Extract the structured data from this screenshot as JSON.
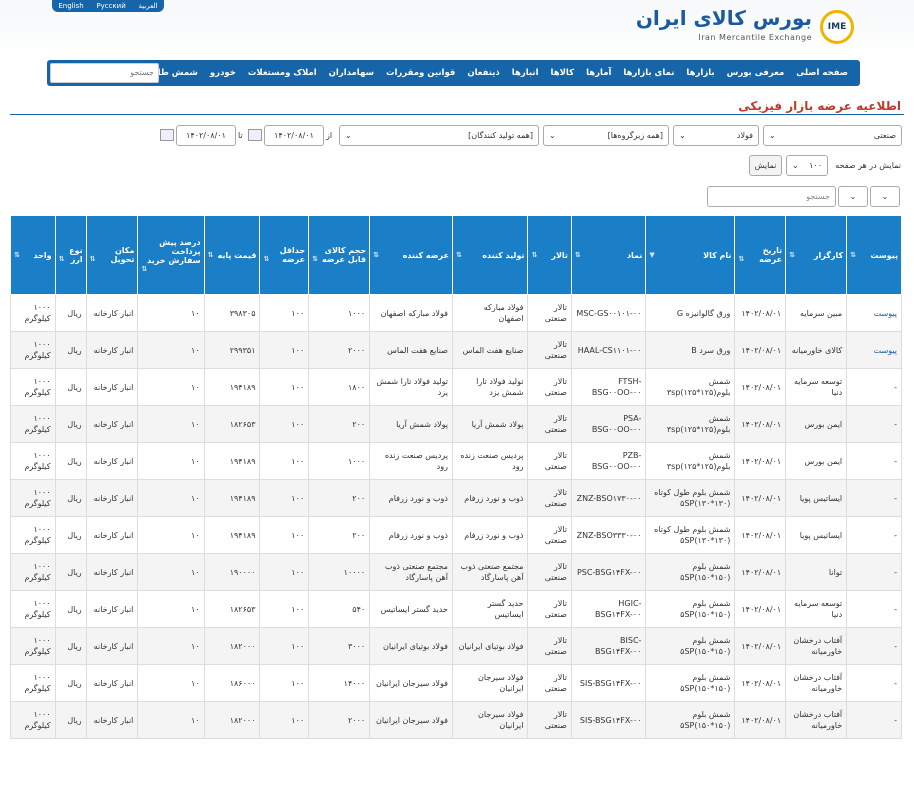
{
  "header": {
    "languages": [
      "English",
      "Русский",
      "العربية"
    ],
    "logo_fa": "بورس کالای ایران",
    "logo_en": "Iran Mercantile Exchange",
    "logo_mark": "IME"
  },
  "nav": {
    "items": [
      "صفحه اصلی",
      "معرفی بورس",
      "بازارها",
      "نمای بازارها",
      "آمارها",
      "کالاها",
      "انبارها",
      "ذینفعان",
      "قوانین ومقررات",
      "سهامداران",
      "املاک ومستغلات",
      "خودرو",
      "شمش طلا"
    ],
    "search_placeholder": "جستجو"
  },
  "page": {
    "title": "اطلاعیه عرضه بازار فیزیکی"
  },
  "filters": {
    "market": "صنعتی",
    "group": "فولاد",
    "subgroup": "[همه زیرگروه‌ها]",
    "producer": "[همه تولید کنندگان]",
    "from_label": "از",
    "from_date": "۱۴۰۲/۰۸/۰۱",
    "to_label": "تا",
    "to_date": "۱۴۰۲/۰۸/۰۱",
    "per_page_label": "نمایش در هر صفحه",
    "per_page": "۱۰۰",
    "show_button": "نمایش",
    "table_search_placeholder": "جستجو"
  },
  "table": {
    "columns": [
      "پیوست",
      "کارگزار",
      "تاریخ عرضه",
      "نام کالا",
      "نماد",
      "تالار",
      "تولید کننده",
      "عرضه کننده",
      "حجم کالای قابل عرضه",
      "حداقل عرضه",
      "قیمت پایه",
      "درصد پیش پرداخت سفارش خرید",
      "مکان تحویل",
      "نوع ارز",
      "واحد"
    ],
    "rows": [
      [
        "پیوست",
        "مبین سرمایه",
        "۱۴۰۲/۰۸/۰۱",
        "ورق گالوانیزه G",
        "MSC-GS۰۰۱۰۱-۰۰",
        "تالار صنعتی",
        "فولاد مبارکه اصفهان",
        "فولاد مبارکه اصفهان",
        "۱۰۰۰",
        "۱۰۰",
        "۳۹۸۳۰۵",
        "۱۰",
        "انبار کارخانه",
        "ریال",
        "۱۰۰۰ کیلوگرم"
      ],
      [
        "پیوست",
        "کالای خاورمیانه",
        "۱۴۰۲/۰۸/۰۱",
        "ورق سرد B",
        "HAAL-CS۱۱۰۱-۰۰",
        "تالار صنعتی",
        "صنایع هفت الماس",
        "صنایع هفت الماس",
        "۲۰۰۰",
        "۱۰۰",
        "۲۹۹۳۵۱",
        "۱۰",
        "انبار کارخانه",
        "ریال",
        "۱۰۰۰ کیلوگرم"
      ],
      [
        "-",
        "توسعه سرمایه دنیا",
        "۱۴۰۲/۰۸/۰۱",
        "شمش بلوم(۱۲۵*۱۲۵)۳sp",
        "FTSH-BSG۰۰OO-۰۰",
        "تالار صنعتی",
        "تولید فولاد تارا شمش یزد",
        "تولید فولاد تارا شمش یزد",
        "۱۸۰۰",
        "۱۰۰",
        "۱۹۴۱۸۹",
        "۱۰",
        "انبار کارخانه",
        "ریال",
        "۱۰۰۰ کیلوگرم"
      ],
      [
        "-",
        "ایمن بورس",
        "۱۴۰۲/۰۸/۰۱",
        "شمش بلوم(۱۲۵*۱۲۵)۳sp",
        "PSA-BSG۰۰OO-۰۰",
        "تالار صنعتی",
        "پولاد شمش آریا",
        "پولاد شمش آریا",
        "۲۰۰",
        "۱۰۰",
        "۱۸۲۶۵۳",
        "۱۰",
        "انبار کارخانه",
        "ریال",
        "۱۰۰۰ کیلوگرم"
      ],
      [
        "-",
        "ایمن بورس",
        "۱۴۰۲/۰۸/۰۱",
        "شمش بلوم(۱۲۵*۱۲۵)۳sp",
        "PZB-BSG۰۰OO-۰۰",
        "تالار صنعتی",
        "پردیس صنعت زنده رود",
        "پردیس صنعت زنده رود",
        "۱۰۰۰",
        "۱۰۰",
        "۱۹۴۱۸۹",
        "۱۰",
        "انبار کارخانه",
        "ریال",
        "۱۰۰۰ کیلوگرم"
      ],
      [
        "-",
        "ایساتیس پویا",
        "۱۴۰۲/۰۸/۰۱",
        "شمش بلوم طول کوتاه ۵SP(۱۳۰*۱۳۰)",
        "ZNZ-BSO۱۷۳۰-۰۰",
        "تالار صنعتی",
        "ذوب و نورد زرفام",
        "ذوب و نورد زرفام",
        "۲۰۰",
        "۱۰۰",
        "۱۹۴۱۸۹",
        "۱۰",
        "انبار کارخانه",
        "ریال",
        "۱۰۰۰ کیلوگرم"
      ],
      [
        "-",
        "ایساتیس پویا",
        "۱۴۰۲/۰۸/۰۱",
        "شمش بلوم طول کوتاه ۵SP(۱۳۰*۱۳۰)",
        "ZNZ-BSO۳۳۳۰-۰۰",
        "تالار صنعتی",
        "ذوب و نورد زرفام",
        "ذوب و نورد زرفام",
        "۲۰۰",
        "۱۰۰",
        "۱۹۴۱۸۹",
        "۱۰",
        "انبار کارخانه",
        "ریال",
        "۱۰۰۰ کیلوگرم"
      ],
      [
        "-",
        "توانا",
        "۱۴۰۲/۰۸/۰۱",
        "شمش بلوم ۵SP(۱۵۰*۱۵۰)",
        "PSC-BSG۱۴FX-۰۰",
        "تالار صنعتی",
        "مجتمع صنعتی ذوب آهن پاسارگاد",
        "مجتمع صنعتی ذوب آهن پاسارگاد",
        "۱۰۰۰۰",
        "۱۰۰",
        "۱۹۰۰۰۰",
        "۱۰",
        "انبار کارخانه",
        "ریال",
        "۱۰۰۰ کیلوگرم"
      ],
      [
        "-",
        "توسعه سرمایه دنیا",
        "۱۴۰۲/۰۸/۰۱",
        "شمش بلوم ۵SP(۱۵۰*۱۵۰)",
        "HGIC-BSG۱۴FX-۰۰",
        "تالار صنعتی",
        "حدید گستر ایساتیس",
        "حدید گستر ایساتیس",
        "۵۴۰",
        "۱۰۰",
        "۱۸۲۶۵۳",
        "۱۰",
        "انبار کارخانه",
        "ریال",
        "۱۰۰۰ کیلوگرم"
      ],
      [
        "-",
        "آفتاب درخشان خاورمیانه",
        "۱۴۰۲/۰۸/۰۱",
        "شمش بلوم ۵SP(۱۵۰*۱۵۰)",
        "BISC-BSG۱۴FX-۰۰",
        "تالار صنعتی",
        "فولاد بوتیای ایرانیان",
        "فولاد بوتیای ایرانیان",
        "۳۰۰۰",
        "۱۰۰",
        "۱۸۲۰۰۰",
        "۱۰",
        "انبار کارخانه",
        "ریال",
        "۱۰۰۰ کیلوگرم"
      ],
      [
        "-",
        "آفتاب درخشان خاورمیانه",
        "۱۴۰۲/۰۸/۰۱",
        "شمش بلوم ۵SP(۱۵۰*۱۵۰)",
        "SIS-BSG۱۴FX-۰۰",
        "تالار صنعتی",
        "فولاد سیرجان ایرانیان",
        "فولاد سیرجان ایرانیان",
        "۱۴۰۰۰",
        "۱۰۰",
        "۱۸۶۰۰۰",
        "۱۰",
        "انبار کارخانه",
        "ریال",
        "۱۰۰۰ کیلوگرم"
      ],
      [
        "-",
        "آفتاب درخشان خاورمیانه",
        "۱۴۰۲/۰۸/۰۱",
        "شمش بلوم ۵SP(۱۵۰*۱۵۰)",
        "SIS-BSG۱۴FX-۰۰",
        "تالار صنعتی",
        "فولاد سیرجان ایرانیان",
        "فولاد سیرجان ایرانیان",
        "۲۰۰۰",
        "۱۰۰",
        "۱۸۲۰۰۰",
        "۱۰",
        "انبار کارخانه",
        "ریال",
        "۱۰۰۰ کیلوگرم"
      ]
    ]
  },
  "colors": {
    "brand": "#1565a8",
    "header": "#1b7fc7",
    "title": "#c0392b"
  }
}
